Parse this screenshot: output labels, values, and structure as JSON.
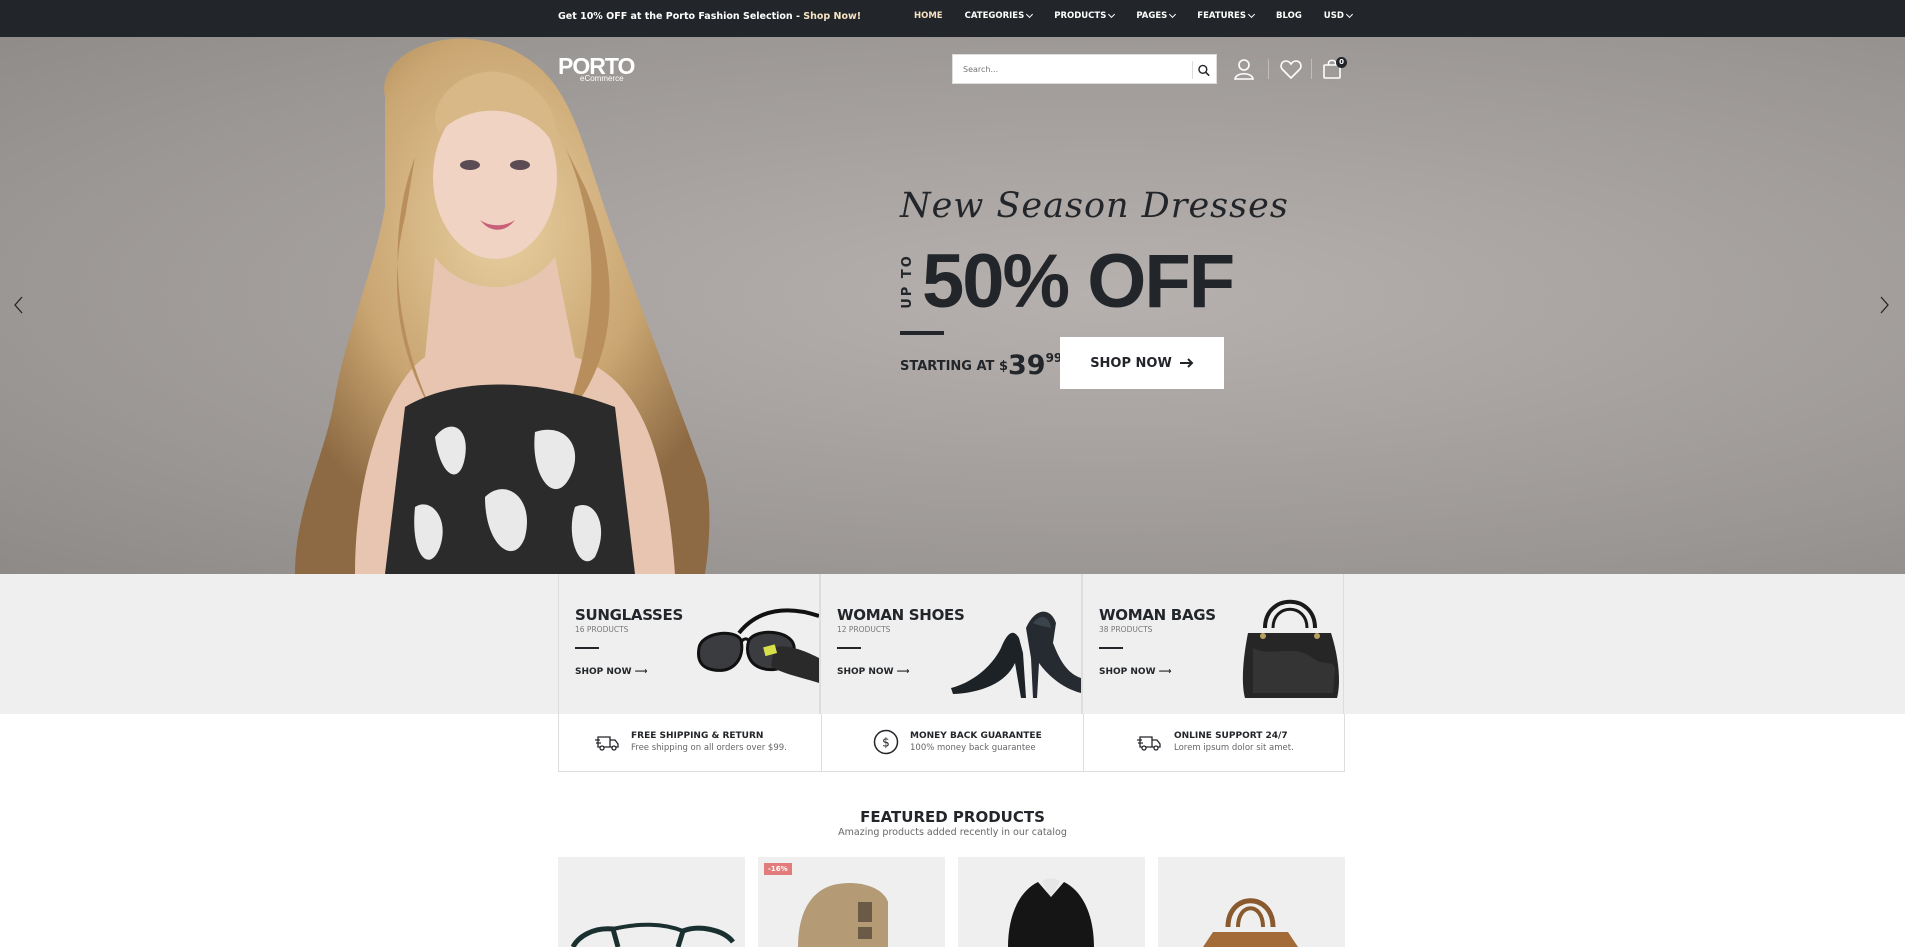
{
  "topbar": {
    "promo_text": "Get 10% OFF at the Porto Fashion Selection - ",
    "promo_link": "Shop Now!",
    "nav": [
      {
        "label": "HOME"
      },
      {
        "label": "CATEGORIES"
      },
      {
        "label": "PRODUCTS"
      },
      {
        "label": "PAGES"
      },
      {
        "label": "FEATURES"
      },
      {
        "label": "BLOG"
      },
      {
        "label": "USD"
      }
    ]
  },
  "header": {
    "logo_main": "PORTO",
    "logo_sub": "eCommerce",
    "search_placeholder": "Search...",
    "cart_count": "0"
  },
  "hero": {
    "script_title": "New Season Dresses",
    "up_to": "UP TO",
    "headline": "50% OFF",
    "starting_label": "STARTING AT ",
    "currency": "$",
    "price": "39",
    "cents": "99",
    "button_label": "SHOP NOW"
  },
  "categories": [
    {
      "title": "SUNGLASSES",
      "count": "16 PRODUCTS",
      "link": "SHOP NOW"
    },
    {
      "title": "WOMAN SHOES",
      "count": "12 PRODUCTS",
      "link": "SHOP NOW"
    },
    {
      "title": "WOMAN BAGS",
      "count": "38 PRODUCTS",
      "link": "SHOP NOW"
    }
  ],
  "features": [
    {
      "title": "FREE SHIPPING & RETURN",
      "subtitle": "Free shipping on all orders over $99.",
      "icon": "truck-icon"
    },
    {
      "title": "MONEY BACK GUARANTEE",
      "subtitle": "100% money back guarantee",
      "icon": "dollar-circle-icon"
    },
    {
      "title": "ONLINE SUPPORT 24/7",
      "subtitle": "Lorem ipsum dolor sit amet.",
      "icon": "truck-icon"
    }
  ],
  "featured": {
    "title": "FEATURED PRODUCTS",
    "subtitle": "Amazing products added recently in our catalog",
    "products": [
      {
        "badge": ""
      },
      {
        "badge": "-16%"
      },
      {
        "badge": ""
      },
      {
        "badge": ""
      }
    ]
  },
  "colors": {
    "dark": "#222529",
    "accent": "#f4e3c3",
    "sale": "#e27c7c"
  }
}
